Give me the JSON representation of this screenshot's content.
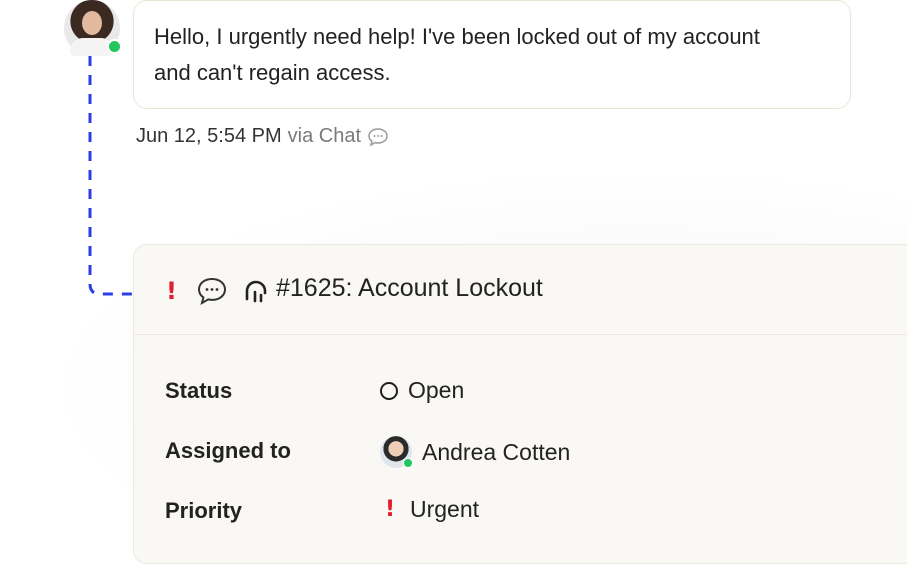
{
  "message": {
    "text": "Hello, I urgently need help! I've been locked out of my account and can't regain access.",
    "timestamp": "Jun 12, 5:54 PM",
    "channel": "via Chat",
    "channel_icon": "chat-bubble-icon",
    "author_status": "online"
  },
  "ticket": {
    "priority_marker": "!",
    "title": "#1625: Account Lockout",
    "fields": {
      "status_label": "Status",
      "status_value": "Open",
      "assigned_label": "Assigned to",
      "assigned_value": "Andrea Cotten",
      "priority_label": "Priority",
      "priority_marker": "!",
      "priority_value": "Urgent"
    }
  },
  "colors": {
    "urgent": "#e11d2e",
    "online": "#22c55e",
    "connector": "#2b3ee6",
    "card_bg": "#faf8f4"
  }
}
